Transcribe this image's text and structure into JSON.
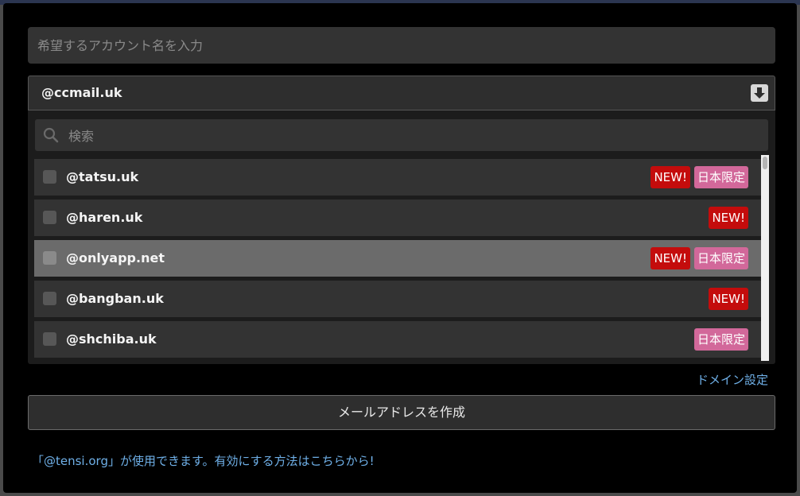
{
  "account": {
    "placeholder": "希望するアカウント名を入力"
  },
  "domain_select": {
    "value": "@ccmail.uk",
    "icon": "download-arrow-icon"
  },
  "search": {
    "placeholder": "検索",
    "icon": "search-icon"
  },
  "domains": [
    {
      "name": "@tatsu.uk",
      "badges": [
        "NEW!",
        "日本限定"
      ],
      "highlighted": false
    },
    {
      "name": "@haren.uk",
      "badges": [
        "NEW!"
      ],
      "highlighted": false
    },
    {
      "name": "@onlyapp.net",
      "badges": [
        "NEW!",
        "日本限定"
      ],
      "highlighted": true
    },
    {
      "name": "@bangban.uk",
      "badges": [
        "NEW!"
      ],
      "highlighted": false
    },
    {
      "name": "@shchiba.uk",
      "badges": [
        "日本限定"
      ],
      "highlighted": false
    }
  ],
  "badge_colors": {
    "NEW!": "#c40c0c",
    "日本限定": "#d2689a"
  },
  "links": {
    "domain_settings": "ドメイン設定"
  },
  "create_button": {
    "label": "メールアドレスを作成"
  },
  "notice": "「@tensi.org」が使用できます。有効にする方法はこちらから!"
}
